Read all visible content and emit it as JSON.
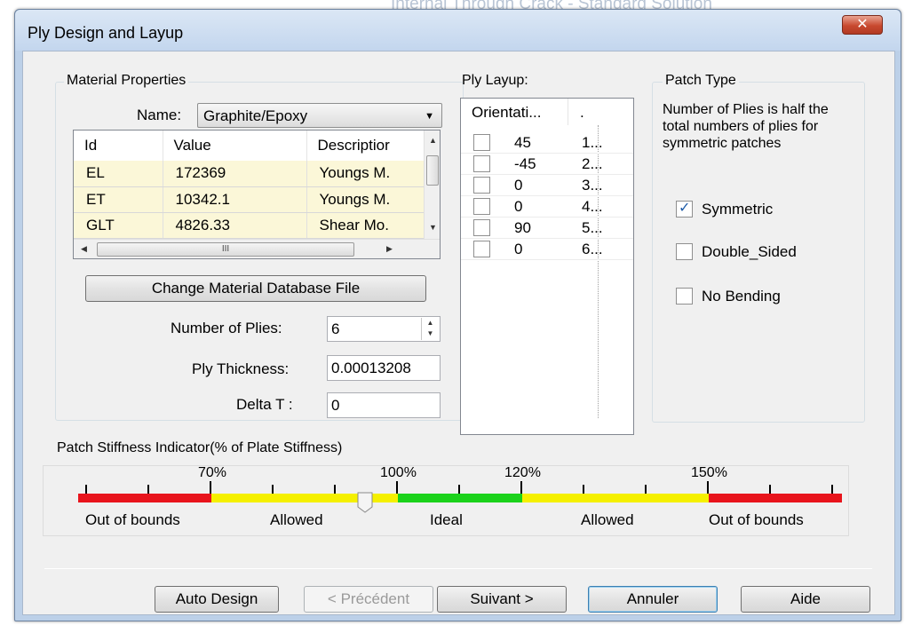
{
  "background_title": "Internal Through Crack - Standard Solution",
  "dialog": {
    "title": "Ply Design and Layup",
    "close_glyph": "✕"
  },
  "material": {
    "group_title": "Material Properties",
    "name_label": "Name:",
    "name_value": "Graphite/Epoxy",
    "table": {
      "headers": [
        "Id",
        "Value",
        "Descriptior"
      ],
      "rows": [
        [
          "EL",
          "172369",
          "Youngs M."
        ],
        [
          "ET",
          "10342.1",
          "Youngs M."
        ],
        [
          "GLT",
          "4826.33",
          "Shear Mo."
        ]
      ]
    },
    "hscroll_grip": "III",
    "change_db_button": "Change Material Database File",
    "num_plies_label": "Number of  Plies:",
    "num_plies_value": "6",
    "ply_thickness_label": "Ply Thickness:",
    "ply_thickness_value": "0.00013208",
    "delta_t_label": "Delta T  :",
    "delta_t_value": "0"
  },
  "ply_layup": {
    "title": "Ply Layup:",
    "headers": [
      "Orientati...",
      "."
    ],
    "rows": [
      {
        "orientation": "45",
        "index": "1..."
      },
      {
        "orientation": "-45",
        "index": "2..."
      },
      {
        "orientation": "0",
        "index": "3..."
      },
      {
        "orientation": "0",
        "index": "4..."
      },
      {
        "orientation": "90",
        "index": "5..."
      },
      {
        "orientation": "0",
        "index": "6..."
      }
    ]
  },
  "patch_type": {
    "title": "Patch Type",
    "note": "Number of Plies is half the total numbers of plies for symmetric patches",
    "options": [
      {
        "label": "Symmetric",
        "checked": true
      },
      {
        "label": "Double_Sided",
        "checked": false
      },
      {
        "label": "No Bending",
        "checked": false
      }
    ]
  },
  "stiffness": {
    "title": "Patch Stiffness Indicator(% of Plate Stiffness)",
    "scale_labels": [
      "70%",
      "100%",
      "120%",
      "150%"
    ],
    "zone_labels": [
      "Out of bounds",
      "Allowed",
      "Ideal",
      "Allowed",
      "Out of bounds"
    ],
    "zone_colors": {
      "out": "#e8141c",
      "allowed": "#f5f000",
      "ideal": "#1bd21b"
    },
    "slider_value_percent": 95
  },
  "buttons": {
    "auto_design": "Auto Design",
    "previous": "< Précédent",
    "next": "Suivant >",
    "cancel": "Annuler",
    "help": "Aide"
  }
}
